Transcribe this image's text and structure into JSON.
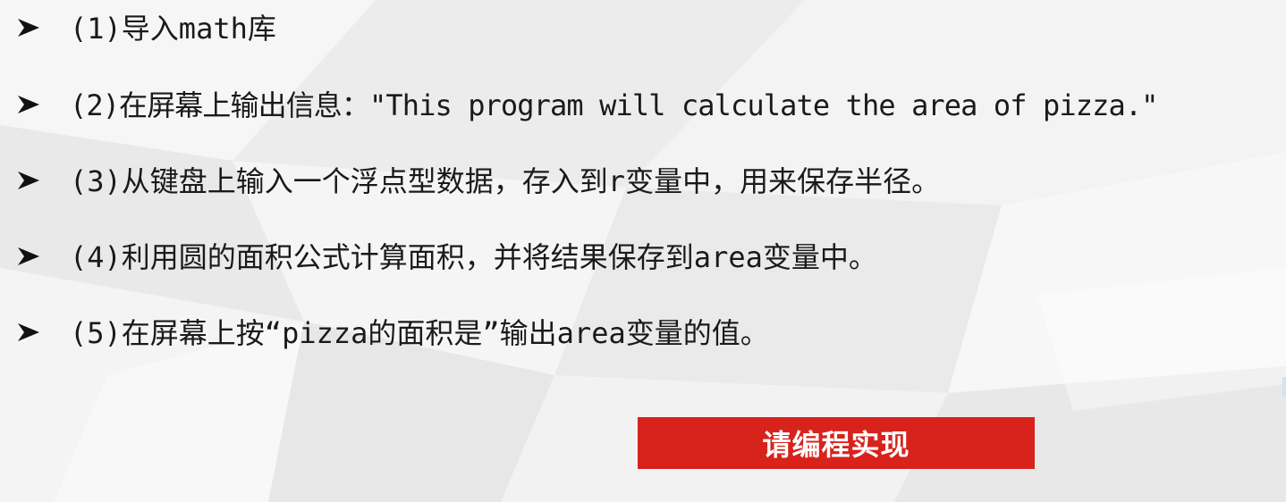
{
  "items": [
    {
      "text": "(1)导入math库"
    },
    {
      "text": "(2)在屏幕上输出信息：\"This program will calculate the area of pizza.\""
    },
    {
      "text": "(3)从键盘上输入一个浮点型数据，存入到r变量中，用来保存半径。"
    },
    {
      "text": "(4)利用圆的面积公式计算面积，并将结果保存到area变量中。"
    },
    {
      "text": "(5)在屏幕上按“pizza的面积是”输出area变量的值。"
    }
  ],
  "cta": {
    "label": "请编程实现"
  },
  "colors": {
    "cta_background": "#d7231c",
    "cta_text": "#ffffff",
    "body_text": "#1a1a1a",
    "bullet": "#111111"
  },
  "icons": {
    "bullet": "arrowhead-bullet-icon"
  }
}
